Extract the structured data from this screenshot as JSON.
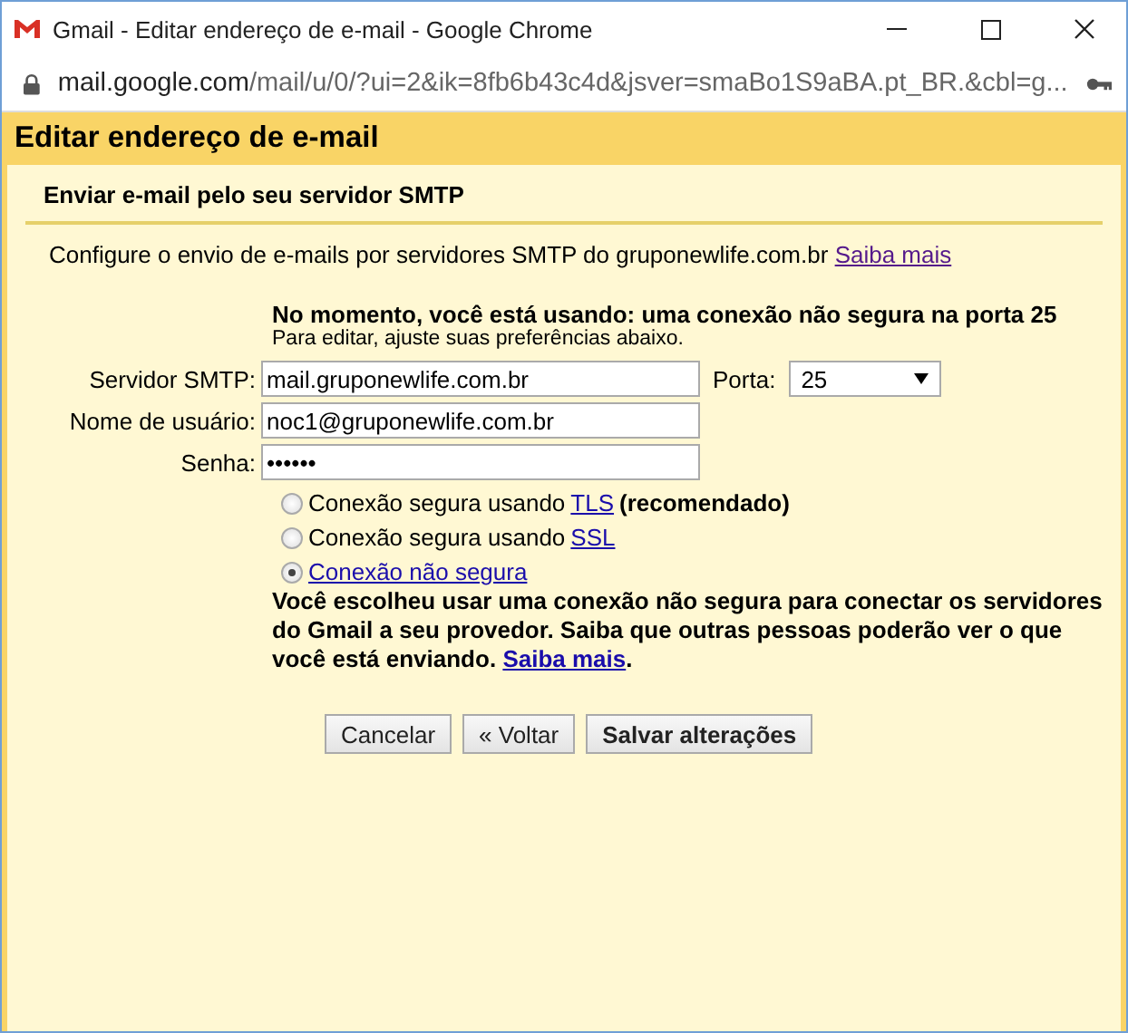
{
  "window": {
    "title": "Gmail - Editar endereço de e-mail - Google Chrome",
    "url_host": "mail.google.com",
    "url_path": "/mail/u/0/?ui=2&ik=8fb6b43c4d&jsver=smaBo1S9aBA.pt_BR.&cbl=g..."
  },
  "dialog": {
    "title": "Editar endereço de e-mail",
    "section_title": "Enviar e-mail pelo seu servidor SMTP",
    "intro": {
      "text": "Configure o envio de e-mails por servidores SMTP do gruponewlife.com.br",
      "link": "Saiba mais"
    },
    "status": {
      "headline": "No momento, você está usando: uma conexão não segura na porta 25",
      "hint": "Para editar, ajuste suas preferências abaixo."
    },
    "fields": [
      {
        "label": "Servidor SMTP:",
        "value": "mail.gruponewlife.com.br",
        "port_label": "Porta:",
        "port_value": "25"
      },
      {
        "label": "Nome de usuário:",
        "value": "noc1@gruponewlife.com.br"
      },
      {
        "label": "Senha:",
        "value": "••••••"
      }
    ],
    "security_options": [
      {
        "prefix": "Conexão segura usando ",
        "link": "TLS",
        "suffix": "(recomendado)",
        "selected": false
      },
      {
        "prefix": "Conexão segura usando ",
        "link": "SSL",
        "selected": false
      },
      {
        "link": "Conexão não segura",
        "selected": true
      }
    ],
    "warning": {
      "text": "Você escolheu usar uma conexão não segura para conectar os servidores do Gmail a seu provedor. Saiba que outras pessoas poderão ver o que você está enviando.",
      "link": "Saiba mais",
      "end": "."
    },
    "buttons": [
      {
        "label": "Cancelar",
        "primary": false
      },
      {
        "label": "« Voltar",
        "primary": false
      },
      {
        "label": "Salvar alterações",
        "primary": true
      }
    ]
  }
}
